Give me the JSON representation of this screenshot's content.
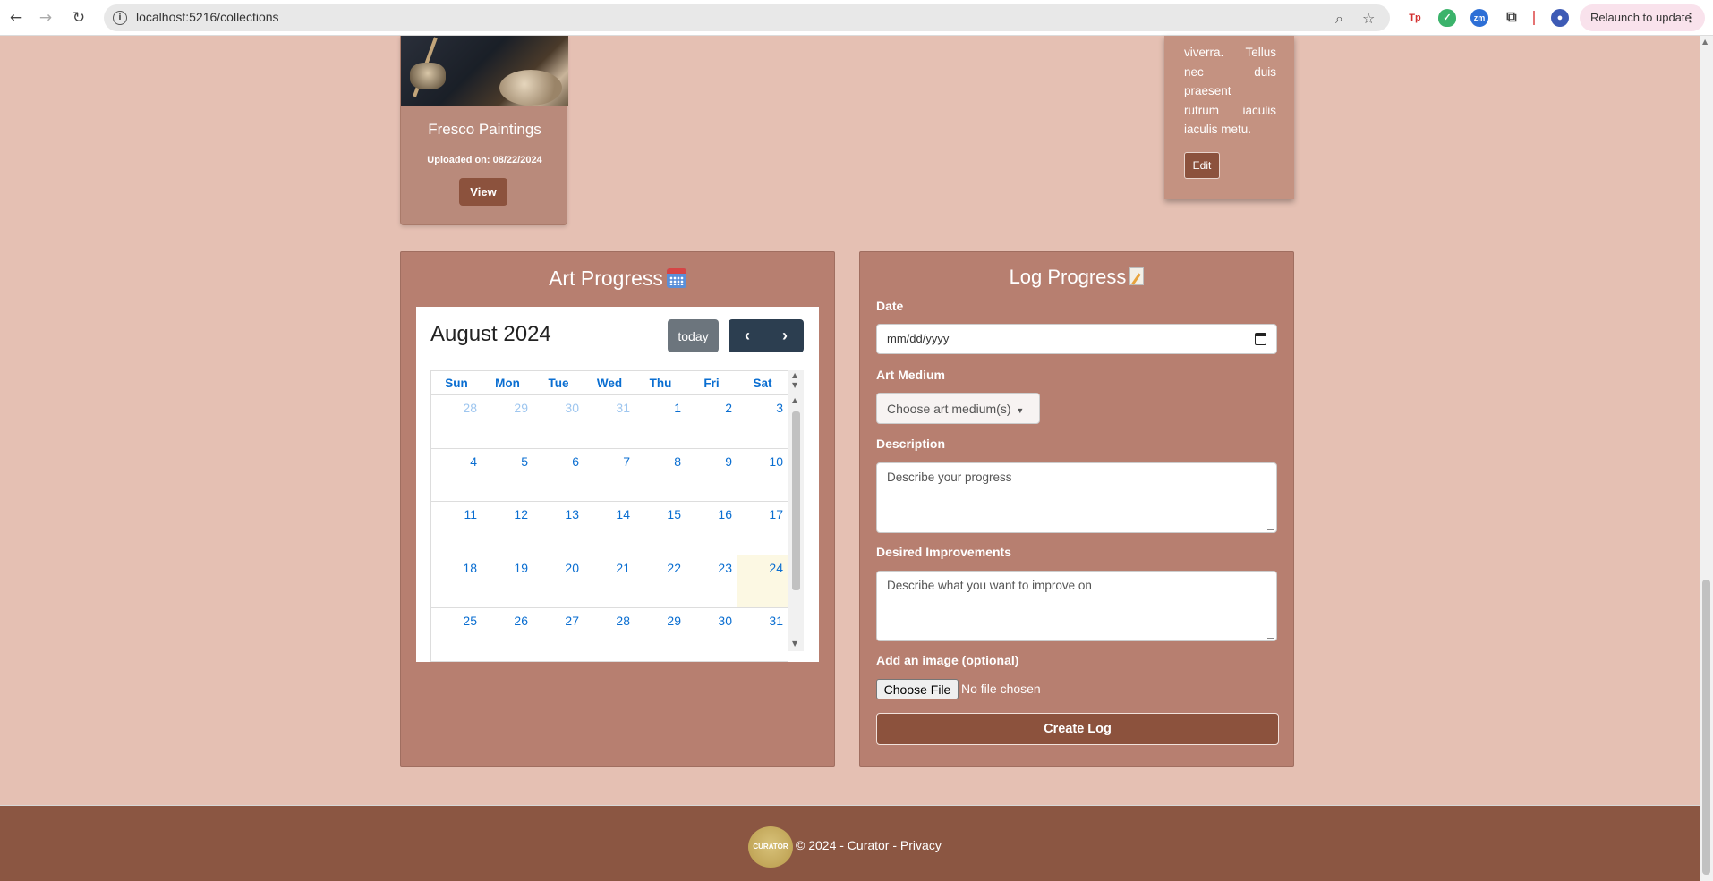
{
  "browser": {
    "url": "localhost:5216/collections",
    "relaunch_label": "Relaunch to update",
    "extensions": [
      "Tp",
      "shield-extension",
      "zm",
      "puzzle-extension",
      "profile"
    ]
  },
  "collection_card": {
    "title": "Fresco Paintings",
    "uploaded": "Uploaded on: 08/22/2024",
    "view_label": "View"
  },
  "side_card": {
    "lines": [
      "viverra. Tellus",
      "nec duis",
      "praesent",
      "rutrum iaculis",
      "iaculis metu."
    ],
    "edit_label": "Edit"
  },
  "art_progress": {
    "title": "Art Progress",
    "calendar": {
      "month_title": "August 2024",
      "today_label": "today",
      "days": [
        "Sun",
        "Mon",
        "Tue",
        "Wed",
        "Thu",
        "Fri",
        "Sat"
      ],
      "weeks": [
        [
          "28",
          "29",
          "30",
          "31",
          "1",
          "2",
          "3"
        ],
        [
          "4",
          "5",
          "6",
          "7",
          "8",
          "9",
          "10"
        ],
        [
          "11",
          "12",
          "13",
          "14",
          "15",
          "16",
          "17"
        ],
        [
          "18",
          "19",
          "20",
          "21",
          "22",
          "23",
          "24"
        ],
        [
          "25",
          "26",
          "27",
          "28",
          "29",
          "30",
          "31"
        ]
      ],
      "today_date": "24"
    }
  },
  "log_progress": {
    "title": "Log Progress",
    "date_label": "Date",
    "date_placeholder": "mm/dd/yyyy",
    "medium_label": "Art Medium",
    "medium_button": "Choose art medium(s)",
    "description_label": "Description",
    "description_placeholder": "Describe your progress",
    "improvements_label": "Desired Improvements",
    "improvements_placeholder": "Describe what you want to improve on",
    "image_label": "Add an image (optional)",
    "file_button": "Choose File",
    "file_status": "No file chosen",
    "submit_label": "Create Log"
  },
  "footer": {
    "logo_text": "CURATOR",
    "text": "© 2024 - Curator - ",
    "privacy": "Privacy"
  },
  "colors": {
    "page_bg": "#e5c0b3",
    "panel_bg": "#b77f70",
    "accent_brown": "#8c523d",
    "footer_bg": "#8b5642",
    "calendar_link": "#0a6ed1"
  }
}
